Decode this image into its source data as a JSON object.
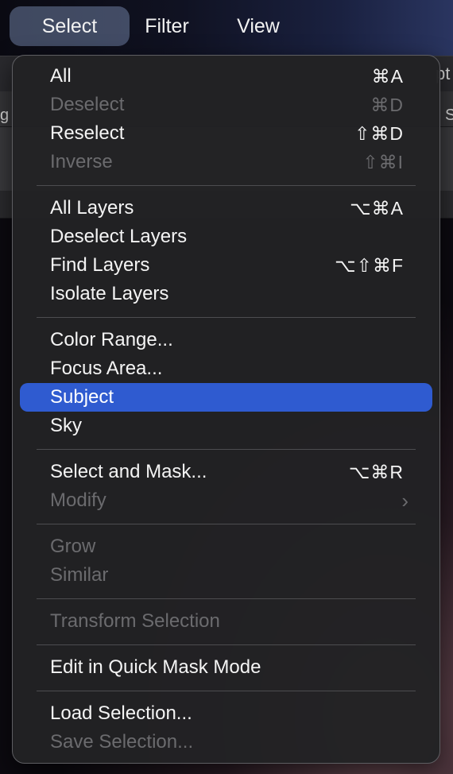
{
  "menubar": {
    "items": [
      {
        "label": "Select",
        "active": true
      },
      {
        "label": "Filter"
      },
      {
        "label": "View"
      }
    ]
  },
  "menu": {
    "groups": [
      [
        {
          "label": "All",
          "shortcut": "⌘A",
          "enabled": true
        },
        {
          "label": "Deselect",
          "shortcut": "⌘D",
          "enabled": false
        },
        {
          "label": "Reselect",
          "shortcut": "⇧⌘D",
          "enabled": true
        },
        {
          "label": "Inverse",
          "shortcut": "⇧⌘I",
          "enabled": false
        }
      ],
      [
        {
          "label": "All Layers",
          "shortcut": "⌥⌘A",
          "enabled": true
        },
        {
          "label": "Deselect Layers",
          "shortcut": "",
          "enabled": true
        },
        {
          "label": "Find Layers",
          "shortcut": "⌥⇧⌘F",
          "enabled": true
        },
        {
          "label": "Isolate Layers",
          "shortcut": "",
          "enabled": true
        }
      ],
      [
        {
          "label": "Color Range...",
          "shortcut": "",
          "enabled": true
        },
        {
          "label": "Focus Area...",
          "shortcut": "",
          "enabled": true
        },
        {
          "label": "Subject",
          "shortcut": "",
          "enabled": true,
          "highlighted": true
        },
        {
          "label": "Sky",
          "shortcut": "",
          "enabled": true
        }
      ],
      [
        {
          "label": "Select and Mask...",
          "shortcut": "⌥⌘R",
          "enabled": true
        },
        {
          "label": "Modify",
          "shortcut": "",
          "enabled": false,
          "submenu": true
        }
      ],
      [
        {
          "label": "Grow",
          "shortcut": "",
          "enabled": false
        },
        {
          "label": "Similar",
          "shortcut": "",
          "enabled": false
        }
      ],
      [
        {
          "label": "Transform Selection",
          "shortcut": "",
          "enabled": false
        }
      ],
      [
        {
          "label": "Edit in Quick Mask Mode",
          "shortcut": "",
          "enabled": true
        }
      ],
      [
        {
          "label": "Load Selection...",
          "shortcut": "",
          "enabled": true
        },
        {
          "label": "Save Selection...",
          "shortcut": "",
          "enabled": false
        }
      ]
    ]
  },
  "background_glyphs": [
    "g",
    "pt",
    "S"
  ],
  "colors": {
    "highlight": "#2f5bd0",
    "menu_bg": "#222224",
    "text": "#f4f4f4",
    "disabled_text": "#6b6b6e",
    "separator": "#4d4d50"
  }
}
